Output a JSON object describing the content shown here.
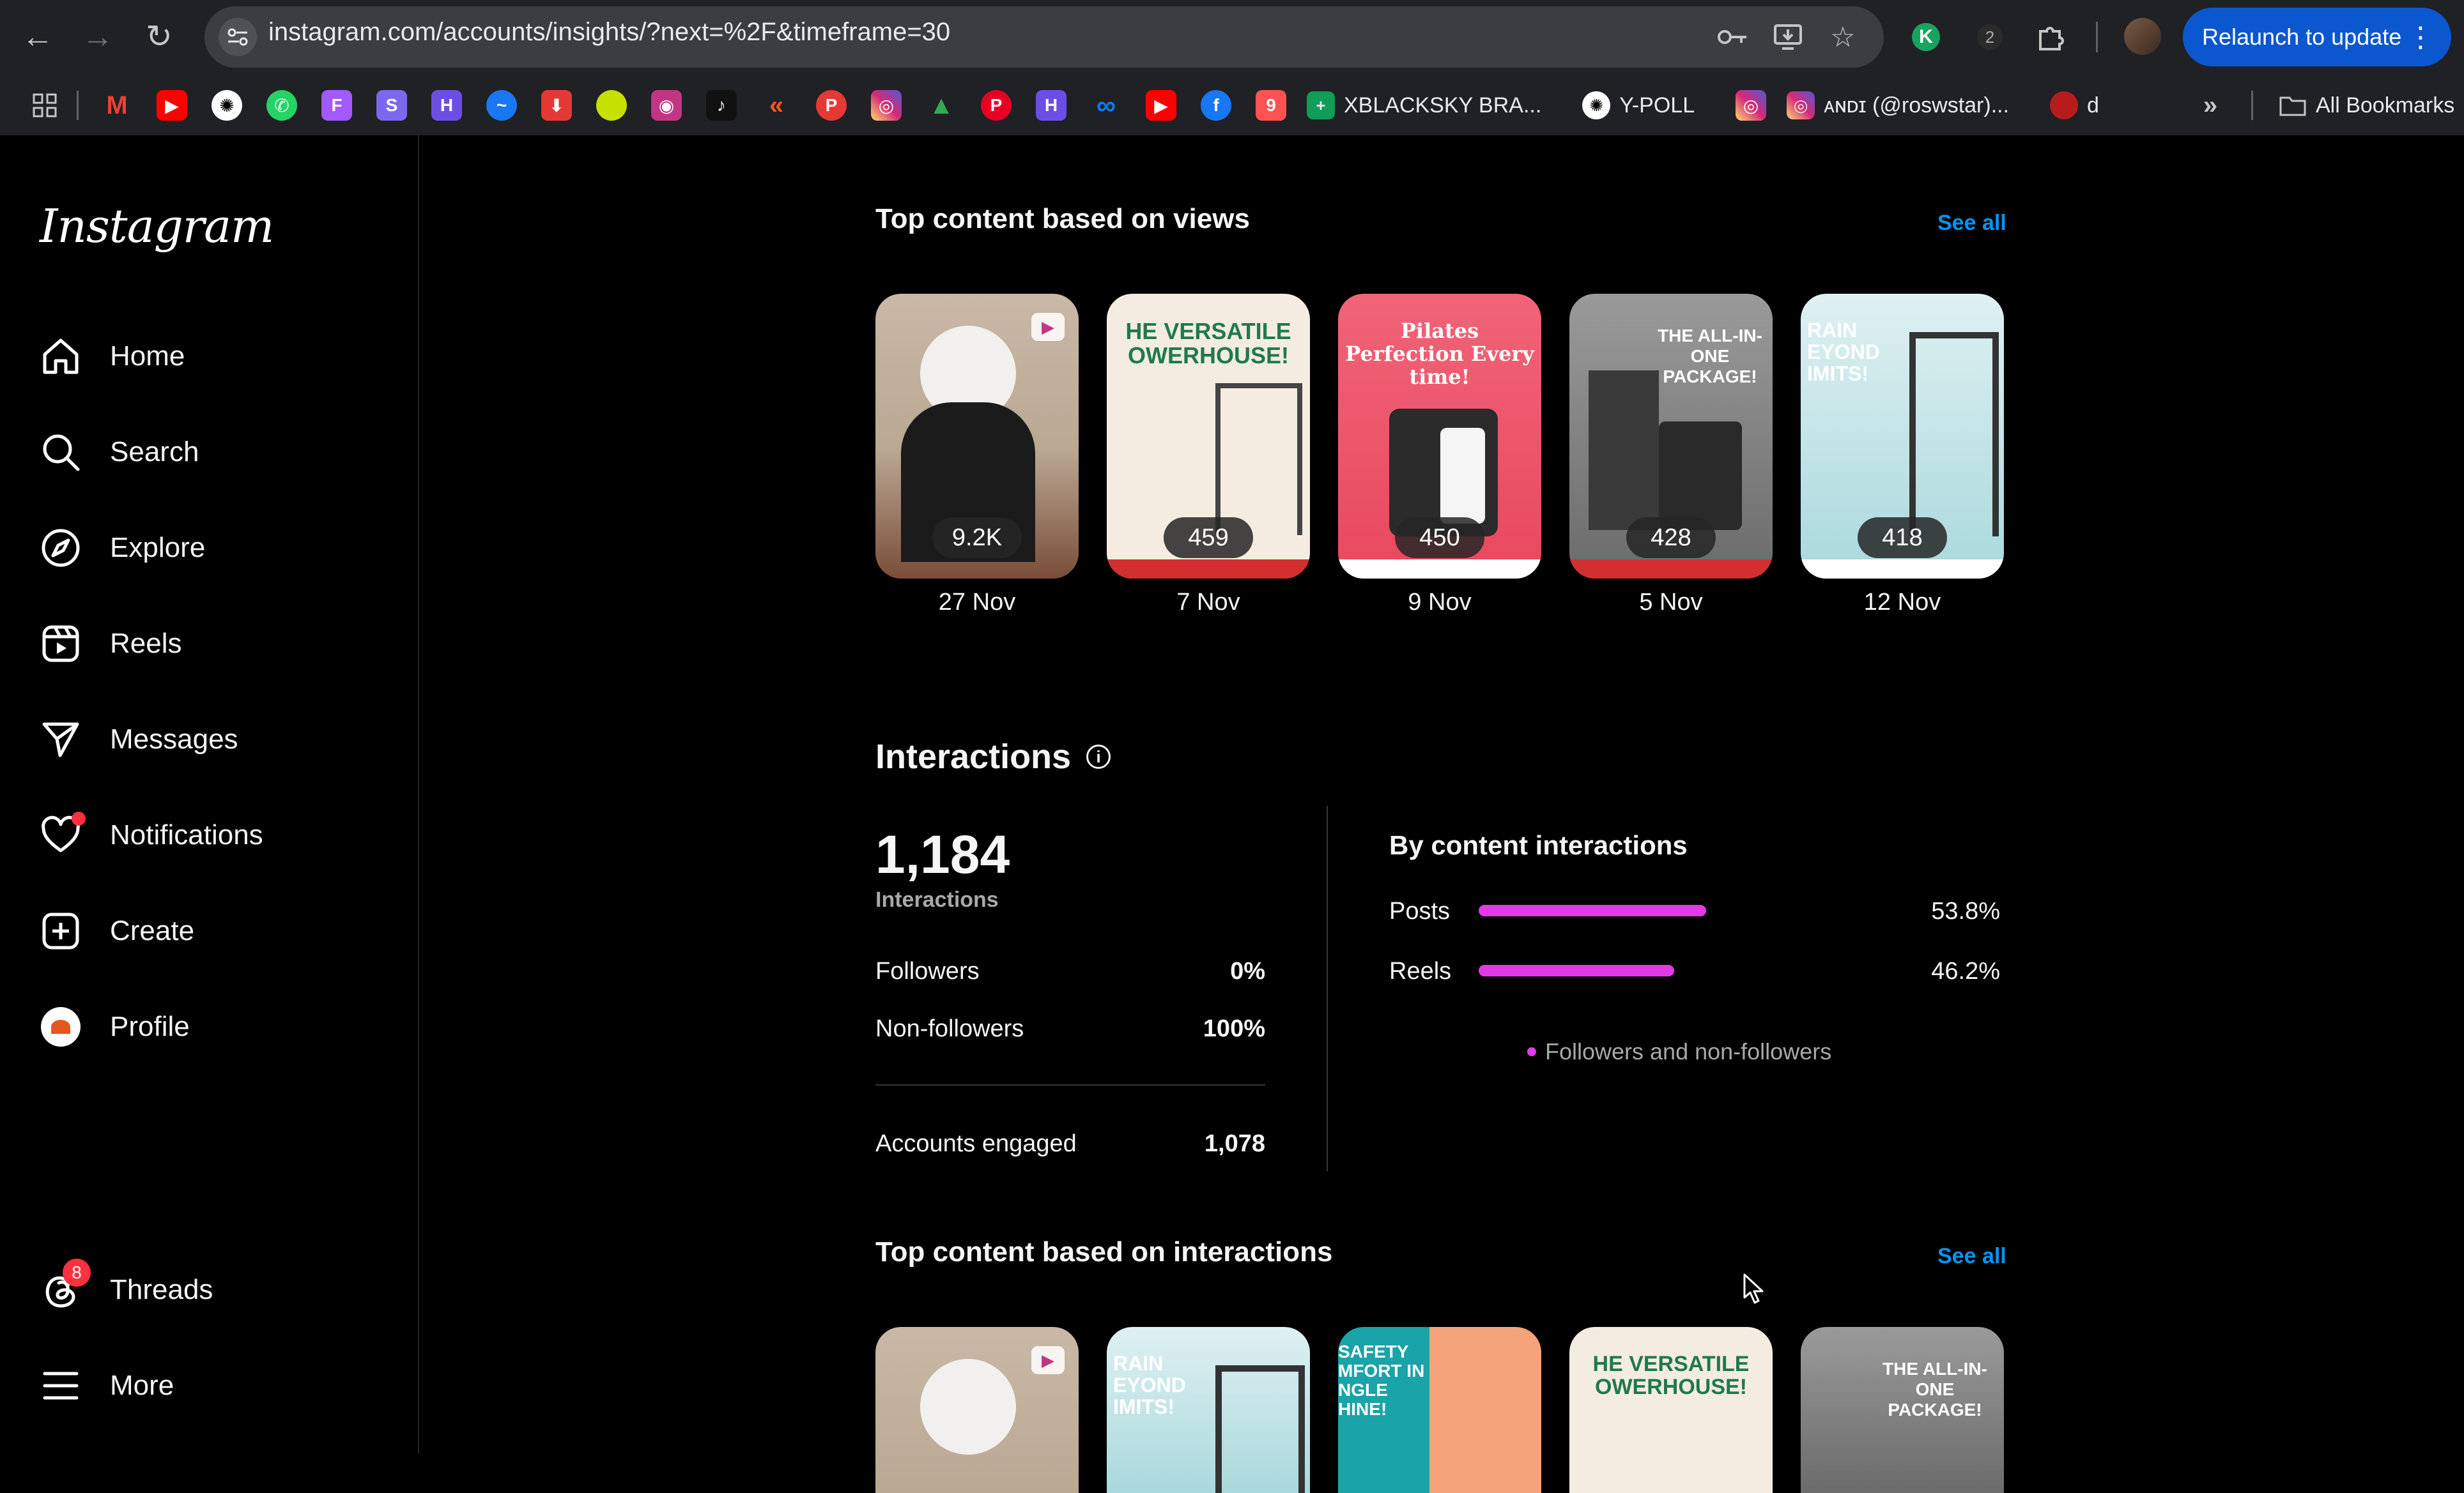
{
  "browser": {
    "url": "instagram.com/accounts/insights/?next=%2F&timeframe=30",
    "relaunch_label": "Relaunch to update",
    "bookmarks_text": [
      "XBLACKSKY BRA...",
      "Y-POLL",
      "ᴀɴᴅɪ (@roswstar)...",
      "d"
    ],
    "all_bookmarks": "All Bookmarks",
    "ext_badge": "2"
  },
  "sidebar": {
    "logo": "Instagram",
    "items": [
      {
        "label": "Home"
      },
      {
        "label": "Search"
      },
      {
        "label": "Explore"
      },
      {
        "label": "Reels"
      },
      {
        "label": "Messages"
      },
      {
        "label": "Notifications"
      },
      {
        "label": "Create"
      },
      {
        "label": "Profile"
      },
      {
        "label": "Threads",
        "badge": "8"
      },
      {
        "label": "More"
      }
    ]
  },
  "top_views": {
    "title": "Top content based on views",
    "see_all": "See all",
    "items": [
      {
        "count": "9.2K",
        "date": "27 Nov"
      },
      {
        "count": "459",
        "date": "7 Nov",
        "caption": "HE VERSATILE OWERHOUSE!"
      },
      {
        "count": "450",
        "date": "9 Nov",
        "caption": "Pilates Perfection Every time!"
      },
      {
        "count": "428",
        "date": "5 Nov",
        "caption": "THE ALL-IN-ONE PACKAGE!"
      },
      {
        "count": "418",
        "date": "12 Nov",
        "caption": "RAIN EYOND IMITS!"
      }
    ]
  },
  "interactions": {
    "title": "Interactions",
    "total": "1,184",
    "total_label": "Interactions",
    "followers_label": "Followers",
    "followers_value": "0%",
    "non_followers_label": "Non-followers",
    "non_followers_value": "100%",
    "engaged_label": "Accounts engaged",
    "engaged_value": "1,078",
    "by_content_title": "By content interactions",
    "rows": [
      {
        "label": "Posts",
        "value": "53.8%",
        "fraction": 0.538
      },
      {
        "label": "Reels",
        "value": "46.2%",
        "fraction": 0.462
      }
    ],
    "legend": "Followers and non-followers",
    "accent": "#e33ae6"
  },
  "top_interactions": {
    "title": "Top content based on interactions",
    "see_all": "See all",
    "captions": [
      "",
      "RAIN EYOND IMITS!",
      "SAFETY MFORT IN NGLE HINE!",
      "HE VERSATILE OWERHOUSE!",
      "THE ALL-IN-ONE PACKAGE!"
    ]
  }
}
